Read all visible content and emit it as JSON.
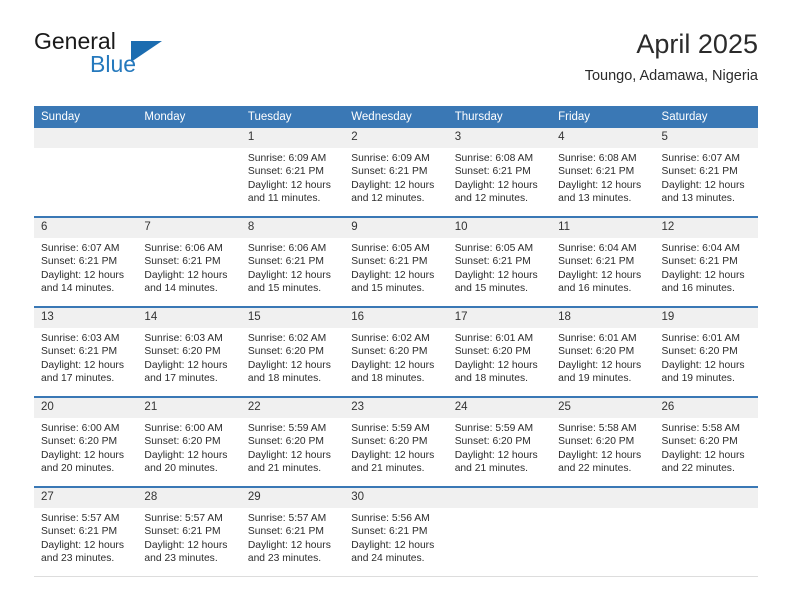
{
  "brand": {
    "name_part1": "General",
    "name_part2": "Blue",
    "triangle_color": "#1b6cb0",
    "blue_color": "#2579bd"
  },
  "header": {
    "title": "April 2025",
    "subtitle": "Toungo, Adamawa, Nigeria"
  },
  "theme": {
    "header_blue": "#3a78b5",
    "daynum_gray": "#f0f0f0"
  },
  "weekday_headers": [
    "Sunday",
    "Monday",
    "Tuesday",
    "Wednesday",
    "Thursday",
    "Friday",
    "Saturday"
  ],
  "weeks": [
    [
      {
        "day": "",
        "sunrise": "",
        "sunset": "",
        "daylight_line1": "",
        "daylight_line2": ""
      },
      {
        "day": "",
        "sunrise": "",
        "sunset": "",
        "daylight_line1": "",
        "daylight_line2": ""
      },
      {
        "day": "1",
        "sunrise": "Sunrise: 6:09 AM",
        "sunset": "Sunset: 6:21 PM",
        "daylight_line1": "Daylight: 12 hours",
        "daylight_line2": "and 11 minutes."
      },
      {
        "day": "2",
        "sunrise": "Sunrise: 6:09 AM",
        "sunset": "Sunset: 6:21 PM",
        "daylight_line1": "Daylight: 12 hours",
        "daylight_line2": "and 12 minutes."
      },
      {
        "day": "3",
        "sunrise": "Sunrise: 6:08 AM",
        "sunset": "Sunset: 6:21 PM",
        "daylight_line1": "Daylight: 12 hours",
        "daylight_line2": "and 12 minutes."
      },
      {
        "day": "4",
        "sunrise": "Sunrise: 6:08 AM",
        "sunset": "Sunset: 6:21 PM",
        "daylight_line1": "Daylight: 12 hours",
        "daylight_line2": "and 13 minutes."
      },
      {
        "day": "5",
        "sunrise": "Sunrise: 6:07 AM",
        "sunset": "Sunset: 6:21 PM",
        "daylight_line1": "Daylight: 12 hours",
        "daylight_line2": "and 13 minutes."
      }
    ],
    [
      {
        "day": "6",
        "sunrise": "Sunrise: 6:07 AM",
        "sunset": "Sunset: 6:21 PM",
        "daylight_line1": "Daylight: 12 hours",
        "daylight_line2": "and 14 minutes."
      },
      {
        "day": "7",
        "sunrise": "Sunrise: 6:06 AM",
        "sunset": "Sunset: 6:21 PM",
        "daylight_line1": "Daylight: 12 hours",
        "daylight_line2": "and 14 minutes."
      },
      {
        "day": "8",
        "sunrise": "Sunrise: 6:06 AM",
        "sunset": "Sunset: 6:21 PM",
        "daylight_line1": "Daylight: 12 hours",
        "daylight_line2": "and 15 minutes."
      },
      {
        "day": "9",
        "sunrise": "Sunrise: 6:05 AM",
        "sunset": "Sunset: 6:21 PM",
        "daylight_line1": "Daylight: 12 hours",
        "daylight_line2": "and 15 minutes."
      },
      {
        "day": "10",
        "sunrise": "Sunrise: 6:05 AM",
        "sunset": "Sunset: 6:21 PM",
        "daylight_line1": "Daylight: 12 hours",
        "daylight_line2": "and 15 minutes."
      },
      {
        "day": "11",
        "sunrise": "Sunrise: 6:04 AM",
        "sunset": "Sunset: 6:21 PM",
        "daylight_line1": "Daylight: 12 hours",
        "daylight_line2": "and 16 minutes."
      },
      {
        "day": "12",
        "sunrise": "Sunrise: 6:04 AM",
        "sunset": "Sunset: 6:21 PM",
        "daylight_line1": "Daylight: 12 hours",
        "daylight_line2": "and 16 minutes."
      }
    ],
    [
      {
        "day": "13",
        "sunrise": "Sunrise: 6:03 AM",
        "sunset": "Sunset: 6:21 PM",
        "daylight_line1": "Daylight: 12 hours",
        "daylight_line2": "and 17 minutes."
      },
      {
        "day": "14",
        "sunrise": "Sunrise: 6:03 AM",
        "sunset": "Sunset: 6:20 PM",
        "daylight_line1": "Daylight: 12 hours",
        "daylight_line2": "and 17 minutes."
      },
      {
        "day": "15",
        "sunrise": "Sunrise: 6:02 AM",
        "sunset": "Sunset: 6:20 PM",
        "daylight_line1": "Daylight: 12 hours",
        "daylight_line2": "and 18 minutes."
      },
      {
        "day": "16",
        "sunrise": "Sunrise: 6:02 AM",
        "sunset": "Sunset: 6:20 PM",
        "daylight_line1": "Daylight: 12 hours",
        "daylight_line2": "and 18 minutes."
      },
      {
        "day": "17",
        "sunrise": "Sunrise: 6:01 AM",
        "sunset": "Sunset: 6:20 PM",
        "daylight_line1": "Daylight: 12 hours",
        "daylight_line2": "and 18 minutes."
      },
      {
        "day": "18",
        "sunrise": "Sunrise: 6:01 AM",
        "sunset": "Sunset: 6:20 PM",
        "daylight_line1": "Daylight: 12 hours",
        "daylight_line2": "and 19 minutes."
      },
      {
        "day": "19",
        "sunrise": "Sunrise: 6:01 AM",
        "sunset": "Sunset: 6:20 PM",
        "daylight_line1": "Daylight: 12 hours",
        "daylight_line2": "and 19 minutes."
      }
    ],
    [
      {
        "day": "20",
        "sunrise": "Sunrise: 6:00 AM",
        "sunset": "Sunset: 6:20 PM",
        "daylight_line1": "Daylight: 12 hours",
        "daylight_line2": "and 20 minutes."
      },
      {
        "day": "21",
        "sunrise": "Sunrise: 6:00 AM",
        "sunset": "Sunset: 6:20 PM",
        "daylight_line1": "Daylight: 12 hours",
        "daylight_line2": "and 20 minutes."
      },
      {
        "day": "22",
        "sunrise": "Sunrise: 5:59 AM",
        "sunset": "Sunset: 6:20 PM",
        "daylight_line1": "Daylight: 12 hours",
        "daylight_line2": "and 21 minutes."
      },
      {
        "day": "23",
        "sunrise": "Sunrise: 5:59 AM",
        "sunset": "Sunset: 6:20 PM",
        "daylight_line1": "Daylight: 12 hours",
        "daylight_line2": "and 21 minutes."
      },
      {
        "day": "24",
        "sunrise": "Sunrise: 5:59 AM",
        "sunset": "Sunset: 6:20 PM",
        "daylight_line1": "Daylight: 12 hours",
        "daylight_line2": "and 21 minutes."
      },
      {
        "day": "25",
        "sunrise": "Sunrise: 5:58 AM",
        "sunset": "Sunset: 6:20 PM",
        "daylight_line1": "Daylight: 12 hours",
        "daylight_line2": "and 22 minutes."
      },
      {
        "day": "26",
        "sunrise": "Sunrise: 5:58 AM",
        "sunset": "Sunset: 6:20 PM",
        "daylight_line1": "Daylight: 12 hours",
        "daylight_line2": "and 22 minutes."
      }
    ],
    [
      {
        "day": "27",
        "sunrise": "Sunrise: 5:57 AM",
        "sunset": "Sunset: 6:21 PM",
        "daylight_line1": "Daylight: 12 hours",
        "daylight_line2": "and 23 minutes."
      },
      {
        "day": "28",
        "sunrise": "Sunrise: 5:57 AM",
        "sunset": "Sunset: 6:21 PM",
        "daylight_line1": "Daylight: 12 hours",
        "daylight_line2": "and 23 minutes."
      },
      {
        "day": "29",
        "sunrise": "Sunrise: 5:57 AM",
        "sunset": "Sunset: 6:21 PM",
        "daylight_line1": "Daylight: 12 hours",
        "daylight_line2": "and 23 minutes."
      },
      {
        "day": "30",
        "sunrise": "Sunrise: 5:56 AM",
        "sunset": "Sunset: 6:21 PM",
        "daylight_line1": "Daylight: 12 hours",
        "daylight_line2": "and 24 minutes."
      },
      {
        "day": "",
        "sunrise": "",
        "sunset": "",
        "daylight_line1": "",
        "daylight_line2": ""
      },
      {
        "day": "",
        "sunrise": "",
        "sunset": "",
        "daylight_line1": "",
        "daylight_line2": ""
      },
      {
        "day": "",
        "sunrise": "",
        "sunset": "",
        "daylight_line1": "",
        "daylight_line2": ""
      }
    ]
  ]
}
